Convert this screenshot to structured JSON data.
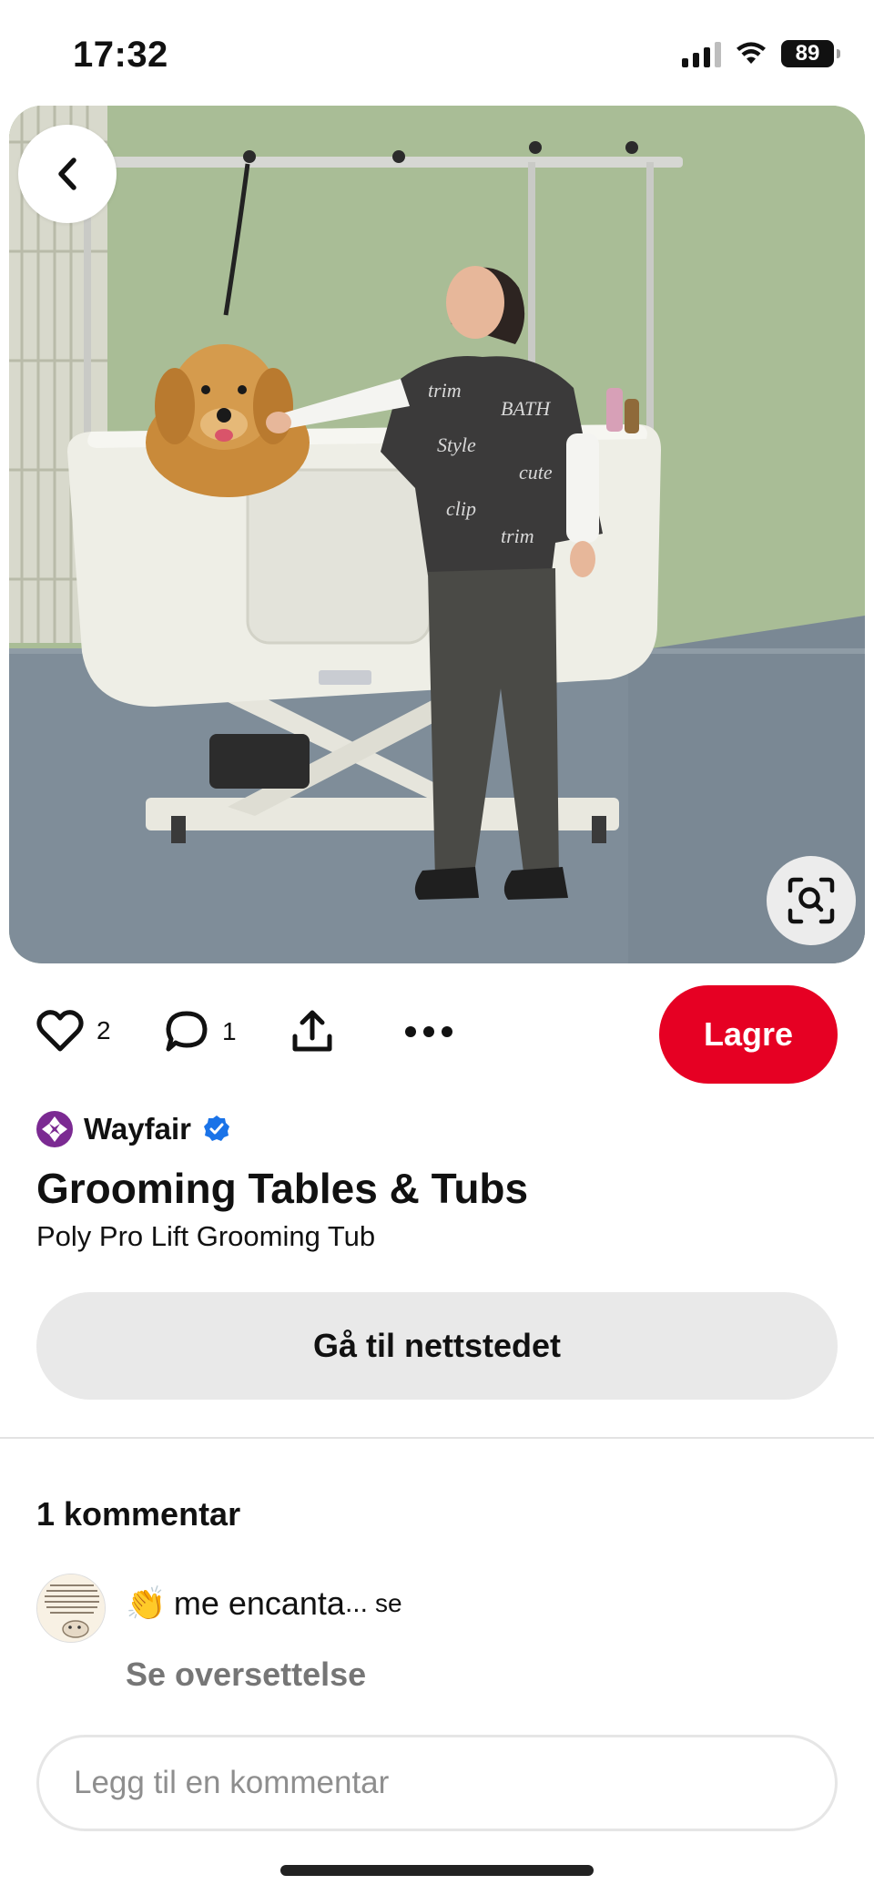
{
  "status_bar": {
    "time": "17:32",
    "battery": "89"
  },
  "pin": {
    "image_alt": "Grooming tub with golden retriever and groomer",
    "back_icon": "chevron-left-icon",
    "visual_search_icon": "lens-search-icon"
  },
  "actions": {
    "likes": "2",
    "comments": "1",
    "save_label": "Lagre"
  },
  "source": {
    "name": "Wayfair",
    "verified": true
  },
  "title": "Grooming Tables & Tubs",
  "subtitle": "Poly Pro Lift Grooming Tub",
  "visit_label": "Gå til nettstedet",
  "comments": {
    "heading": "1 kommentar",
    "items": [
      {
        "emoji": "👏",
        "text": "me encanta",
        "ellipsis": "...",
        "more": "se",
        "translate": "Se oversettelse"
      }
    ],
    "input_placeholder": "Legg til en kommentar"
  },
  "colors": {
    "save": "#e60023",
    "visit_bg": "#e9e9e9",
    "verified": "#1a73e8"
  }
}
